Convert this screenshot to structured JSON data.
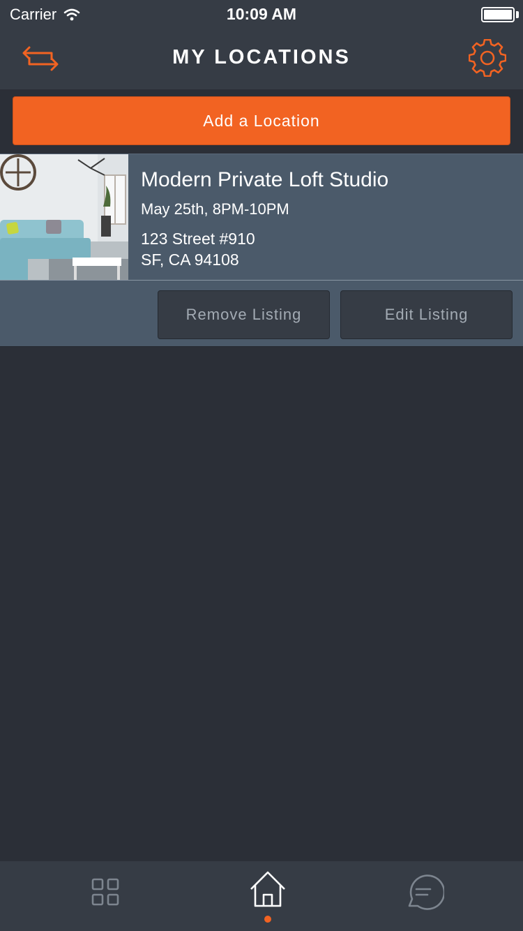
{
  "status_bar": {
    "carrier": "Carrier",
    "time": "10:09 AM"
  },
  "nav": {
    "title": "MY LOCATIONS",
    "left_icon": "switch-arrows-icon",
    "right_icon": "gear-icon"
  },
  "add_button": {
    "label": "Add a Location"
  },
  "listing": {
    "title": "Modern Private Loft Studio",
    "date": "May 25th, 8PM-10PM",
    "address_line1": "123 Street #910",
    "address_line2": "SF, CA 94108",
    "remove_label": "Remove Listing",
    "edit_label": "Edit Listing"
  },
  "tabs": [
    {
      "icon": "grid-icon",
      "active": false
    },
    {
      "icon": "home-icon",
      "active": true
    },
    {
      "icon": "chat-icon",
      "active": false
    }
  ],
  "colors": {
    "accent": "#f26322",
    "background": "#2b2f37",
    "bar": "#363c45",
    "card": "#4b5a6a"
  }
}
